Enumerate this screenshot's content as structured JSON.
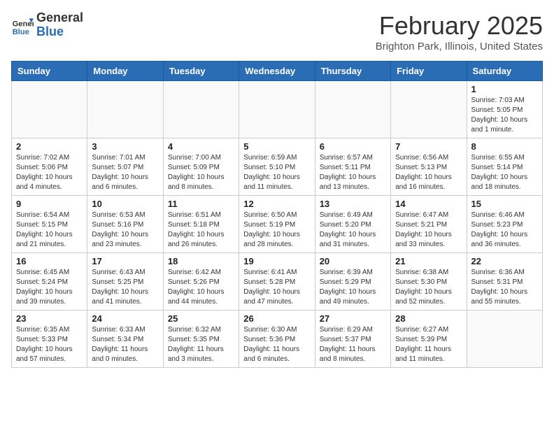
{
  "header": {
    "logo_general": "General",
    "logo_blue": "Blue",
    "title": "February 2025",
    "subtitle": "Brighton Park, Illinois, United States"
  },
  "weekdays": [
    "Sunday",
    "Monday",
    "Tuesday",
    "Wednesday",
    "Thursday",
    "Friday",
    "Saturday"
  ],
  "weeks": [
    [
      {
        "day": "",
        "info": ""
      },
      {
        "day": "",
        "info": ""
      },
      {
        "day": "",
        "info": ""
      },
      {
        "day": "",
        "info": ""
      },
      {
        "day": "",
        "info": ""
      },
      {
        "day": "",
        "info": ""
      },
      {
        "day": "1",
        "info": "Sunrise: 7:03 AM\nSunset: 5:05 PM\nDaylight: 10 hours\nand 1 minute."
      }
    ],
    [
      {
        "day": "2",
        "info": "Sunrise: 7:02 AM\nSunset: 5:06 PM\nDaylight: 10 hours\nand 4 minutes."
      },
      {
        "day": "3",
        "info": "Sunrise: 7:01 AM\nSunset: 5:07 PM\nDaylight: 10 hours\nand 6 minutes."
      },
      {
        "day": "4",
        "info": "Sunrise: 7:00 AM\nSunset: 5:09 PM\nDaylight: 10 hours\nand 8 minutes."
      },
      {
        "day": "5",
        "info": "Sunrise: 6:59 AM\nSunset: 5:10 PM\nDaylight: 10 hours\nand 11 minutes."
      },
      {
        "day": "6",
        "info": "Sunrise: 6:57 AM\nSunset: 5:11 PM\nDaylight: 10 hours\nand 13 minutes."
      },
      {
        "day": "7",
        "info": "Sunrise: 6:56 AM\nSunset: 5:13 PM\nDaylight: 10 hours\nand 16 minutes."
      },
      {
        "day": "8",
        "info": "Sunrise: 6:55 AM\nSunset: 5:14 PM\nDaylight: 10 hours\nand 18 minutes."
      }
    ],
    [
      {
        "day": "9",
        "info": "Sunrise: 6:54 AM\nSunset: 5:15 PM\nDaylight: 10 hours\nand 21 minutes."
      },
      {
        "day": "10",
        "info": "Sunrise: 6:53 AM\nSunset: 5:16 PM\nDaylight: 10 hours\nand 23 minutes."
      },
      {
        "day": "11",
        "info": "Sunrise: 6:51 AM\nSunset: 5:18 PM\nDaylight: 10 hours\nand 26 minutes."
      },
      {
        "day": "12",
        "info": "Sunrise: 6:50 AM\nSunset: 5:19 PM\nDaylight: 10 hours\nand 28 minutes."
      },
      {
        "day": "13",
        "info": "Sunrise: 6:49 AM\nSunset: 5:20 PM\nDaylight: 10 hours\nand 31 minutes."
      },
      {
        "day": "14",
        "info": "Sunrise: 6:47 AM\nSunset: 5:21 PM\nDaylight: 10 hours\nand 33 minutes."
      },
      {
        "day": "15",
        "info": "Sunrise: 6:46 AM\nSunset: 5:23 PM\nDaylight: 10 hours\nand 36 minutes."
      }
    ],
    [
      {
        "day": "16",
        "info": "Sunrise: 6:45 AM\nSunset: 5:24 PM\nDaylight: 10 hours\nand 39 minutes."
      },
      {
        "day": "17",
        "info": "Sunrise: 6:43 AM\nSunset: 5:25 PM\nDaylight: 10 hours\nand 41 minutes."
      },
      {
        "day": "18",
        "info": "Sunrise: 6:42 AM\nSunset: 5:26 PM\nDaylight: 10 hours\nand 44 minutes."
      },
      {
        "day": "19",
        "info": "Sunrise: 6:41 AM\nSunset: 5:28 PM\nDaylight: 10 hours\nand 47 minutes."
      },
      {
        "day": "20",
        "info": "Sunrise: 6:39 AM\nSunset: 5:29 PM\nDaylight: 10 hours\nand 49 minutes."
      },
      {
        "day": "21",
        "info": "Sunrise: 6:38 AM\nSunset: 5:30 PM\nDaylight: 10 hours\nand 52 minutes."
      },
      {
        "day": "22",
        "info": "Sunrise: 6:36 AM\nSunset: 5:31 PM\nDaylight: 10 hours\nand 55 minutes."
      }
    ],
    [
      {
        "day": "23",
        "info": "Sunrise: 6:35 AM\nSunset: 5:33 PM\nDaylight: 10 hours\nand 57 minutes."
      },
      {
        "day": "24",
        "info": "Sunrise: 6:33 AM\nSunset: 5:34 PM\nDaylight: 11 hours\nand 0 minutes."
      },
      {
        "day": "25",
        "info": "Sunrise: 6:32 AM\nSunset: 5:35 PM\nDaylight: 11 hours\nand 3 minutes."
      },
      {
        "day": "26",
        "info": "Sunrise: 6:30 AM\nSunset: 5:36 PM\nDaylight: 11 hours\nand 6 minutes."
      },
      {
        "day": "27",
        "info": "Sunrise: 6:29 AM\nSunset: 5:37 PM\nDaylight: 11 hours\nand 8 minutes."
      },
      {
        "day": "28",
        "info": "Sunrise: 6:27 AM\nSunset: 5:39 PM\nDaylight: 11 hours\nand 11 minutes."
      },
      {
        "day": "",
        "info": ""
      }
    ]
  ]
}
